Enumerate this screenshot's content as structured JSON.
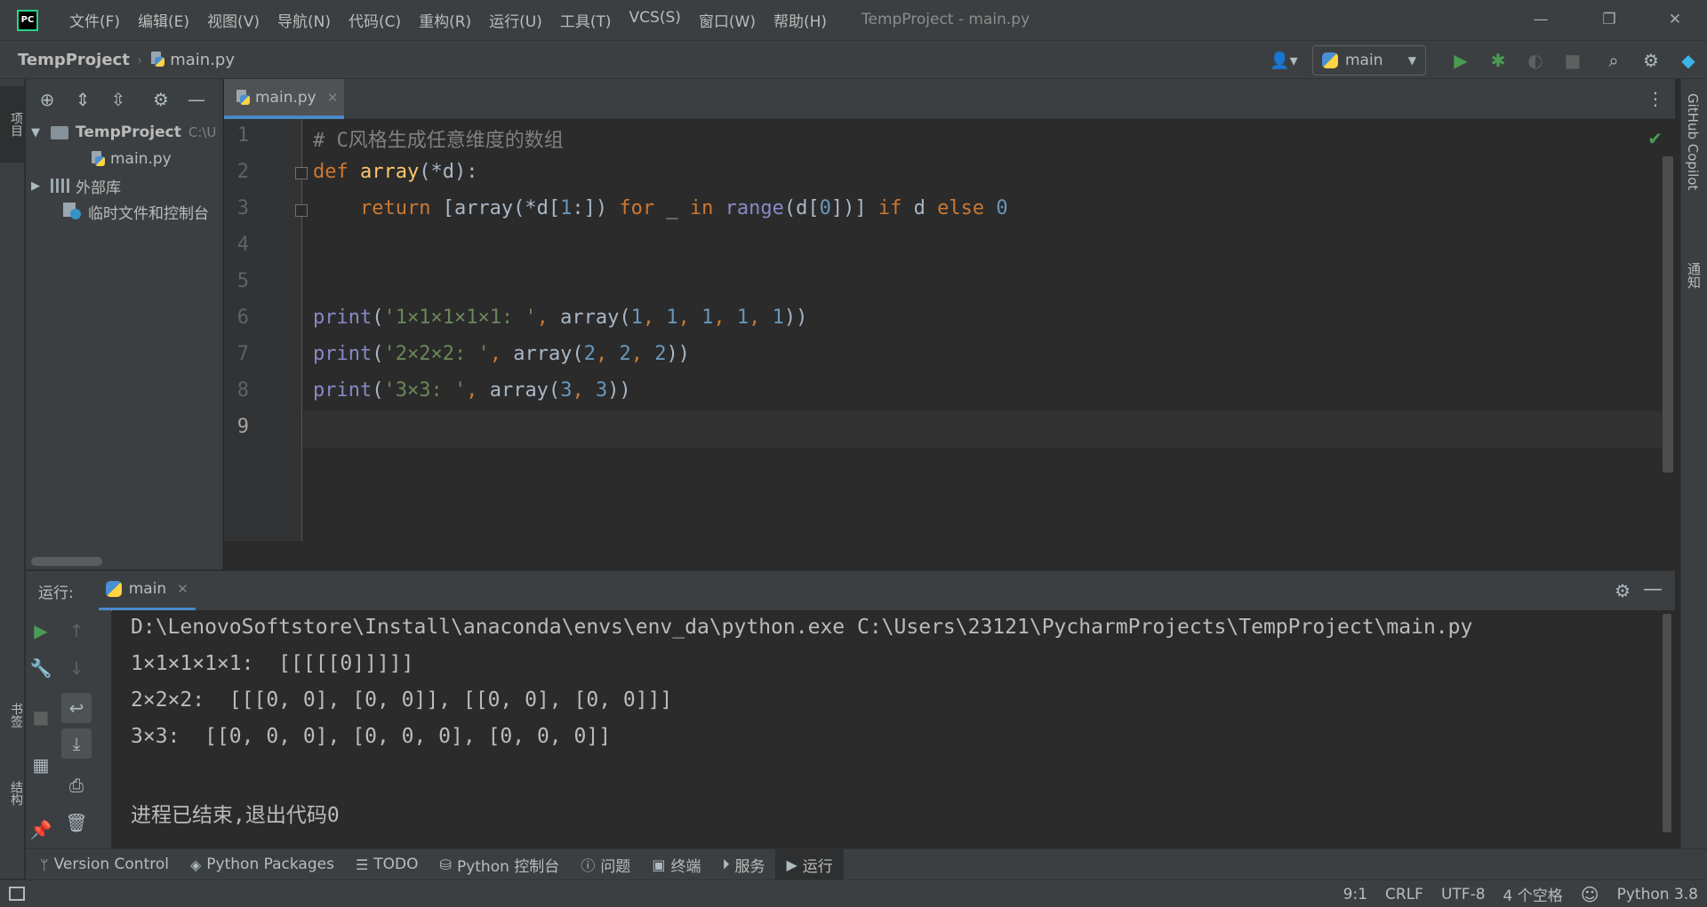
{
  "titlebar": {
    "logo_text": "PC",
    "menu": [
      "文件(F)",
      "编辑(E)",
      "视图(V)",
      "导航(N)",
      "代码(C)",
      "重构(R)",
      "运行(U)",
      "工具(T)",
      "VCS(S)",
      "窗口(W)",
      "帮助(H)"
    ],
    "window_title": "TempProject - main.py",
    "minimize": "—",
    "restore": "❐",
    "close": "✕"
  },
  "navbar": {
    "project": "TempProject",
    "separator": "›",
    "file": "main.py",
    "run_config": "main"
  },
  "stripes": {
    "left_top": "项目",
    "left_bookmarks": "书签",
    "left_structure": "结构",
    "right_copilot": "GitHub Copilot",
    "right_notifications": "通知"
  },
  "project_tree": {
    "root": "TempProject",
    "root_path": "C:\\U",
    "file": "main.py",
    "external_libs": "外部库",
    "scratches": "临时文件和控制台"
  },
  "editor": {
    "tab": "main.py",
    "line_numbers": [
      "1",
      "2",
      "3",
      "4",
      "5",
      "6",
      "7",
      "8",
      "9"
    ],
    "current_line": 9
  },
  "run": {
    "title": "运行:",
    "tab": "main",
    "console": [
      "D:\\LenovoSoftstore\\Install\\anaconda\\envs\\env_da\\python.exe C:\\Users\\23121\\PycharmProjects\\TempProject\\main.py",
      "1×1×1×1×1:  [[[[[0]]]]]",
      "2×2×2:  [[[0, 0], [0, 0]], [[0, 0], [0, 0]]]",
      "3×3:  [[0, 0, 0], [0, 0, 0], [0, 0, 0]]",
      "",
      "进程已结束,退出代码0"
    ]
  },
  "bottom_tools": [
    {
      "label": "Version Control",
      "icon": "branch-icon"
    },
    {
      "label": "Python Packages",
      "icon": "layers-icon"
    },
    {
      "label": "TODO",
      "icon": "list-icon"
    },
    {
      "label": "Python 控制台",
      "icon": "python-icon"
    },
    {
      "label": "问题",
      "icon": "info-icon"
    },
    {
      "label": "终端",
      "icon": "terminal-icon"
    },
    {
      "label": "服务",
      "icon": "play-circle-icon"
    },
    {
      "label": "运行",
      "icon": "play-icon"
    }
  ],
  "status": {
    "position": "9:1",
    "line_sep": "CRLF",
    "encoding": "UTF-8",
    "indent": "4 个空格",
    "interpreter": "Python 3.8"
  },
  "colors": {
    "accent": "#4a88c7",
    "run_green": "#499c54",
    "keyword": "#cc7832",
    "function": "#ffc66d",
    "builtin": "#8888c6",
    "string": "#6a8759",
    "number": "#6897bb",
    "comment": "#808080"
  }
}
